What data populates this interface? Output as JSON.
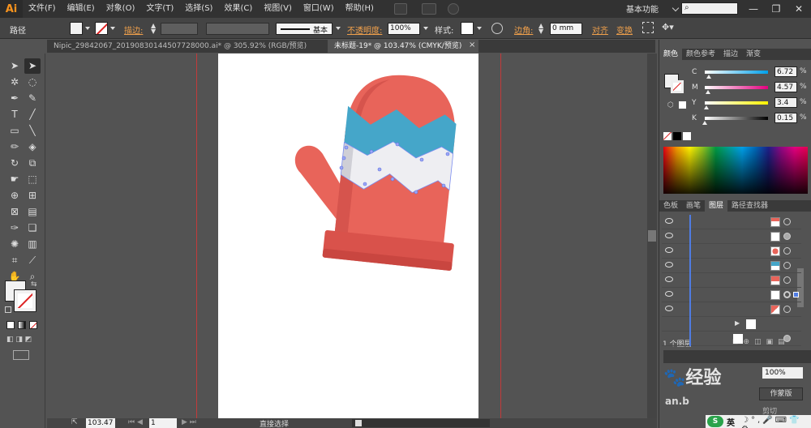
{
  "menubar": {
    "logo": "Ai",
    "items": [
      "文件(F)",
      "编辑(E)",
      "对象(O)",
      "文字(T)",
      "选择(S)",
      "效果(C)",
      "视图(V)",
      "窗口(W)",
      "帮助(H)"
    ],
    "workspace": "基本功能",
    "window_buttons": [
      "—",
      "❐",
      "✕"
    ]
  },
  "control_bar": {
    "object_type": "路径",
    "stroke_label": "描边:",
    "stroke_style": "基本",
    "opacity_label": "不透明度:",
    "opacity_value": "100%",
    "style_label": "样式:",
    "corner_label": "边角:",
    "corner_value": "0 mm",
    "align_label": "对齐",
    "transform_label": "变换"
  },
  "tabs": [
    {
      "label": "Nipic_29842067_20190830144507728000.ai* @ 305.92% (RGB/预览)",
      "active": false
    },
    {
      "label": "未标题-19* @ 103.47% (CMYK/预览)",
      "active": true
    }
  ],
  "color_panel": {
    "tabs": [
      "颜色",
      "颜色参考",
      "描边",
      "渐变"
    ],
    "channels": [
      {
        "name": "C",
        "value": "6.72",
        "fraction": 0.07,
        "color": "#00a0e9"
      },
      {
        "name": "M",
        "value": "4.57",
        "fraction": 0.05,
        "color": "#e4007f"
      },
      {
        "name": "Y",
        "value": "3.4",
        "fraction": 0.03,
        "color": "#fff100"
      },
      {
        "name": "K",
        "value": "0.15",
        "fraction": 0.0,
        "color": "#000000"
      }
    ]
  },
  "layers_panel": {
    "tabs": [
      "色板",
      "画笔",
      "图层",
      "路径查找器"
    ],
    "footer": "1 个图层"
  },
  "status_bar": {
    "zoom": "103.47",
    "page": "1",
    "tool": "直接选择"
  },
  "watermark": {
    "text": "经验",
    "subtext": "an.b",
    "button": "作蒙版",
    "clip": "剪切",
    "opacity": "100%"
  },
  "taskbar": {
    "ime": "英"
  },
  "icons": [
    "selection-tool-icon",
    "direct-selection-tool-icon",
    "magic-wand-icon",
    "lasso-icon",
    "pen-icon",
    "curvature-icon",
    "type-icon",
    "line-icon",
    "rectangle-icon",
    "paintbrush-icon",
    "pencil-icon",
    "eraser-icon",
    "rotate-icon",
    "scale-icon",
    "warp-icon",
    "free-transform-icon",
    "shape-builder-icon",
    "perspective-icon",
    "mesh-icon",
    "gradient-icon",
    "eyedropper-icon",
    "blend-icon",
    "symbol-sprayer-icon",
    "column-graph-icon",
    "artboard-icon",
    "slice-icon",
    "hand-icon",
    "zoom-icon"
  ],
  "colors": {
    "mitten_red": "#e8645a",
    "mitten_cuff": "#d9524b",
    "stripe_blue": "#45a6c9",
    "stripe_white": "#eeeef2"
  }
}
